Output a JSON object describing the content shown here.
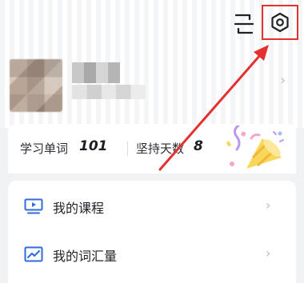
{
  "stats": {
    "words_label": "学习单词",
    "words_value": "101",
    "days_label": "坚持天数",
    "days_value": "8"
  },
  "menu": {
    "items": [
      {
        "label": "我的课程",
        "icon": "video-course-icon"
      },
      {
        "label": "我的词汇量",
        "icon": "chart-trend-icon"
      }
    ]
  },
  "colors": {
    "accent": "#2f6bd8",
    "highlight": "#e53030"
  }
}
